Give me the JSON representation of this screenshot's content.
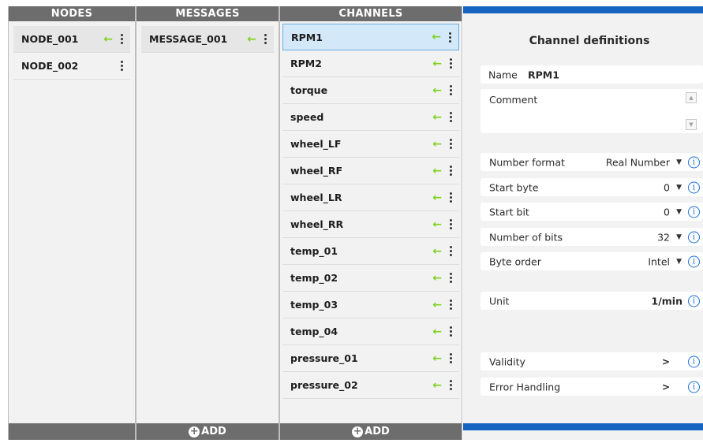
{
  "nodes": {
    "header": "NODES",
    "items": [
      {
        "label": "NODE_001"
      },
      {
        "label": "NODE_002"
      }
    ]
  },
  "messages": {
    "header": "MESSAGES",
    "items": [
      {
        "label": "MESSAGE_001"
      }
    ],
    "add_label": "ADD"
  },
  "channels": {
    "header": "CHANNELS",
    "selected": "RPM1",
    "items": [
      {
        "label": "RPM1"
      },
      {
        "label": "RPM2"
      },
      {
        "label": "torque"
      },
      {
        "label": "speed"
      },
      {
        "label": "wheel_LF"
      },
      {
        "label": "wheel_RF"
      },
      {
        "label": "wheel_LR"
      },
      {
        "label": "wheel_RR"
      },
      {
        "label": "temp_01"
      },
      {
        "label": "temp_02"
      },
      {
        "label": "temp_03"
      },
      {
        "label": "temp_04"
      },
      {
        "label": "pressure_01"
      },
      {
        "label": "pressure_02"
      }
    ],
    "add_label": "ADD"
  },
  "icons": {
    "arrow": "left-arrow-icon",
    "more": "kebab-menu-icon",
    "add": "plus-circle-icon",
    "info": "info-icon",
    "chevron": "chevron-right-icon",
    "dropdown": "caret-down-icon"
  },
  "colors": {
    "header_bg": "#6d6d6d",
    "arrow": "#7ed321",
    "selection_bg": "#d3e8f8",
    "accent_bar": "#1565c0",
    "info": "#1e6fd6"
  },
  "definitions": {
    "title": "Channel definitions",
    "name_label": "Name",
    "name_value": "RPM1",
    "comment_label": "Comment",
    "number_format": {
      "label": "Number format",
      "value": "Real Number"
    },
    "start_byte": {
      "label": "Start byte",
      "value": "0"
    },
    "start_bit": {
      "label": "Start bit",
      "value": "0"
    },
    "number_of_bits": {
      "label": "Number of bits",
      "value": "32"
    },
    "byte_order": {
      "label": "Byte order",
      "value": "Intel"
    },
    "unit": {
      "label": "Unit",
      "value": "1/min"
    },
    "validity": {
      "label": "Validity",
      "chevron": ">"
    },
    "error_handling": {
      "label": "Error Handling",
      "chevron": ">"
    },
    "info_glyph": "i"
  }
}
